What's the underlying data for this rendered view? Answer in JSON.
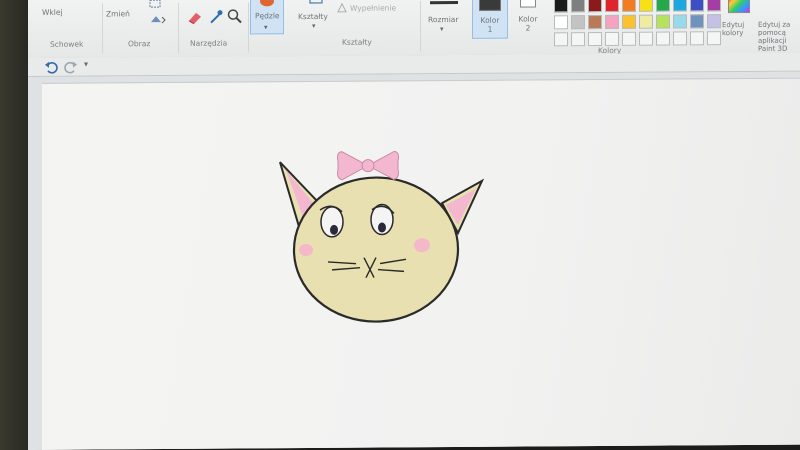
{
  "ribbon": {
    "tools": {
      "brushes_label": "Pędzle",
      "shapes_label": "Kształty",
      "outline_label": "Wypełnienie",
      "size_label": "Rozmiar",
      "color1_label": "Kolor 1",
      "color2_label": "Kolor 2",
      "edit_colors_label": "Edytuj kolory",
      "paint3d_label": "Edytuj za pomocą aplikacji Paint 3D",
      "top_left_label": "Wklej",
      "resize_label": "Zmień"
    },
    "groups": {
      "clipboard": "Schowek",
      "image": "Obraz",
      "tools": "Narzędzia",
      "shapes": "Kształty",
      "colors": "Kolory"
    },
    "palette_row1": [
      "#1a1a1a",
      "#7f7f7f",
      "#8b1a1a",
      "#e0242b",
      "#f47b20",
      "#f7e016",
      "#23a84a",
      "#1fa8e0",
      "#3c4fc4",
      "#a43ea4"
    ],
    "palette_row2": [
      "#ffffff",
      "#c3c3c3",
      "#b97a57",
      "#f5a3c0",
      "#f9c22e",
      "#eeeba3",
      "#b6e25c",
      "#9ad9ea",
      "#7092be",
      "#c6bfe6"
    ],
    "color1": "#3a3a3a",
    "color2": "#ffffff"
  },
  "drawing": {
    "face_color": "#e8e0b0",
    "outline_color": "#2a2a2a",
    "bow_color": "#f3b8cf",
    "ear_inner_color": "#f3b8cf",
    "cheek_color": "#f5b8c8"
  }
}
